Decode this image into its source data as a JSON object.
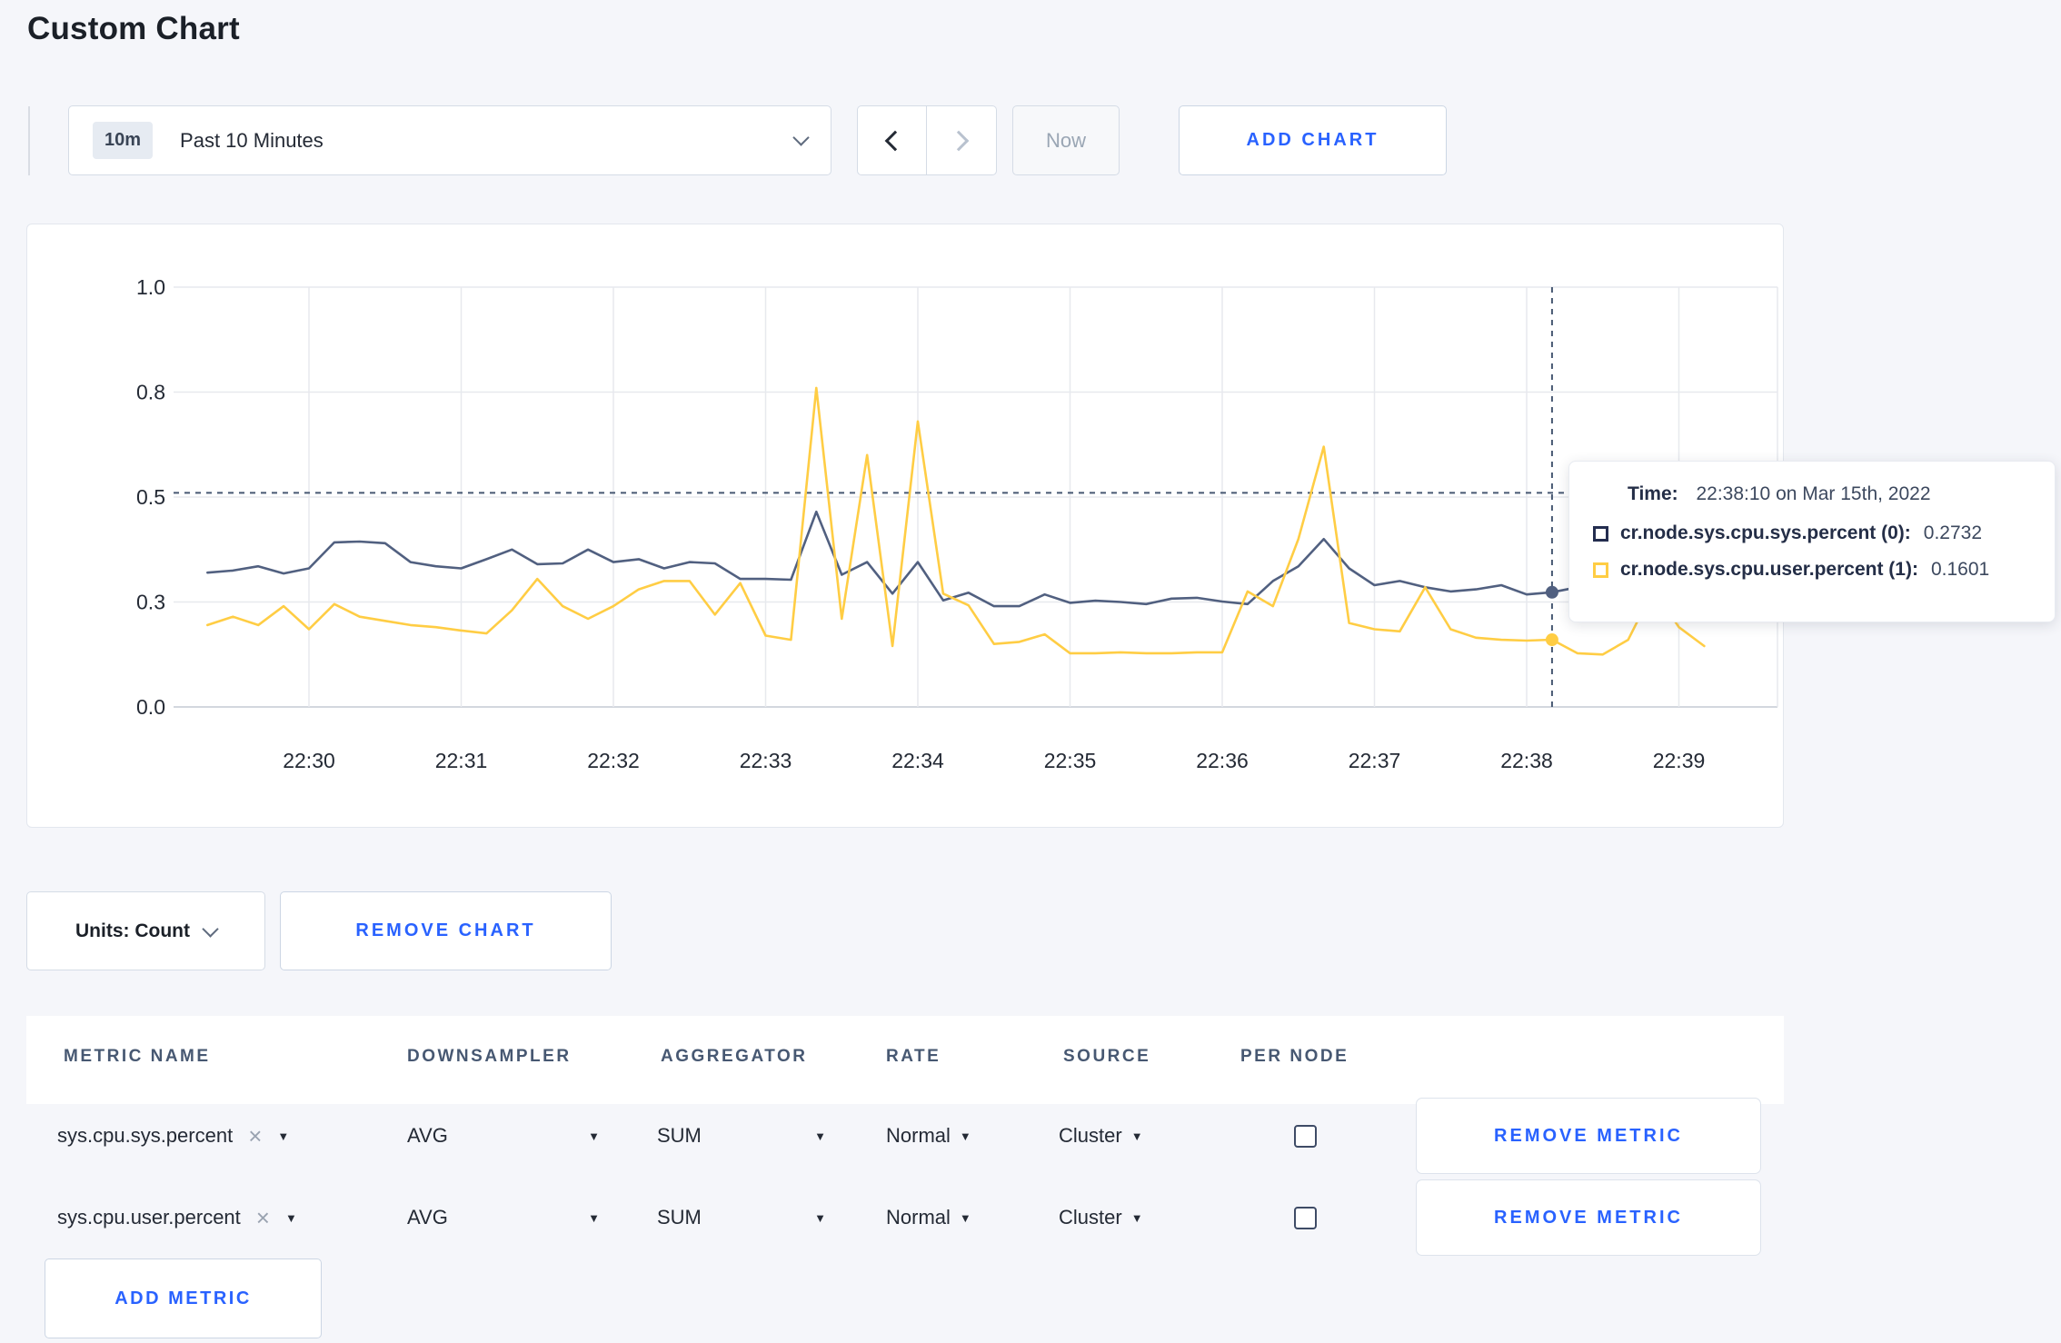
{
  "page": {
    "title": "Custom Chart"
  },
  "toolbar": {
    "time_window": {
      "badge": "10m",
      "label": "Past 10 Minutes"
    },
    "now_label": "Now",
    "add_chart_label": "ADD CHART"
  },
  "chart_card": {
    "tooltip": {
      "time_label": "Time:",
      "time_value": "22:38:10 on Mar 15th, 2022",
      "rows": [
        {
          "name": "cr.node.sys.cpu.sys.percent (0):",
          "value": "0.2732",
          "swatch": "#232d4f"
        },
        {
          "name": "cr.node.sys.cpu.user.percent (1):",
          "value": "0.1601",
          "swatch": "#ffcd44"
        }
      ]
    }
  },
  "chart_data": {
    "type": "line",
    "title": "",
    "xlabel": "",
    "ylabel": "",
    "ylim": [
      0,
      1
    ],
    "grid": true,
    "legend_position": "tooltip",
    "x_ticks": [
      "22:30",
      "22:31",
      "22:32",
      "22:33",
      "22:34",
      "22:35",
      "22:36",
      "22:37",
      "22:38",
      "22:39"
    ],
    "y_ticks": [
      {
        "label": "0.0",
        "value": 0
      },
      {
        "label": "0.3",
        "value": 0.25
      },
      {
        "label": "0.5",
        "value": 0.5
      },
      {
        "label": "0.8",
        "value": 0.75
      },
      {
        "label": "1.0",
        "value": 1.0
      }
    ],
    "x_start": "22:29:20",
    "x_step_seconds": 10,
    "series": [
      {
        "name": "cr.node.sys.cpu.sys.percent (0)",
        "color": "#516080",
        "values": [
          0.32,
          0.325,
          0.335,
          0.318,
          0.33,
          0.392,
          0.394,
          0.39,
          0.345,
          0.335,
          0.33,
          0.352,
          0.375,
          0.34,
          0.342,
          0.375,
          0.345,
          0.352,
          0.33,
          0.345,
          0.342,
          0.305,
          0.305,
          0.303,
          0.465,
          0.315,
          0.345,
          0.27,
          0.345,
          0.254,
          0.272,
          0.24,
          0.24,
          0.268,
          0.248,
          0.253,
          0.25,
          0.245,
          0.258,
          0.26,
          0.251,
          0.245,
          0.3,
          0.335,
          0.4,
          0.33,
          0.29,
          0.3,
          0.285,
          0.275,
          0.28,
          0.29,
          0.268,
          0.2732,
          0.285,
          0.295,
          0.3,
          0.305,
          0.3,
          0.31
        ]
      },
      {
        "name": "cr.node.sys.cpu.user.percent (1)",
        "color": "#ffcd44",
        "values": [
          0.195,
          0.215,
          0.195,
          0.24,
          0.185,
          0.245,
          0.215,
          0.205,
          0.195,
          0.19,
          0.182,
          0.175,
          0.23,
          0.305,
          0.24,
          0.21,
          0.24,
          0.28,
          0.3,
          0.3,
          0.22,
          0.295,
          0.17,
          0.16,
          0.76,
          0.21,
          0.6,
          0.145,
          0.68,
          0.27,
          0.242,
          0.15,
          0.155,
          0.173,
          0.128,
          0.128,
          0.13,
          0.128,
          0.128,
          0.13,
          0.13,
          0.275,
          0.24,
          0.4,
          0.62,
          0.2,
          0.185,
          0.18,
          0.285,
          0.185,
          0.165,
          0.16,
          0.158,
          0.1601,
          0.128,
          0.125,
          0.16,
          0.28,
          0.19,
          0.145
        ]
      }
    ],
    "crosshair": {
      "time": "22:38:10",
      "x_offset_seconds_from_2230": 490,
      "hline_value": 0.51,
      "dot_values": [
        0.2732,
        0.1601
      ]
    }
  },
  "units_row": {
    "units_label": "Units: Count",
    "remove_chart_label": "REMOVE CHART"
  },
  "metrics_table": {
    "columns": [
      "METRIC NAME",
      "DOWNSAMPLER",
      "AGGREGATOR",
      "RATE",
      "SOURCE",
      "PER NODE"
    ],
    "rows": [
      {
        "metric": "sys.cpu.sys.percent",
        "remove_x": "×",
        "downsampler": "AVG",
        "aggregator": "SUM",
        "rate": "Normal",
        "source": "Cluster",
        "per_node_checked": false,
        "remove_label": "REMOVE METRIC"
      },
      {
        "metric": "sys.cpu.user.percent",
        "remove_x": "×",
        "downsampler": "AVG",
        "aggregator": "SUM",
        "rate": "Normal",
        "source": "Cluster",
        "per_node_checked": false,
        "remove_label": "REMOVE METRIC"
      }
    ],
    "add_metric_label": "ADD METRIC"
  },
  "colors": {
    "accent_blue": "#2962ff",
    "series_sys": "#516080",
    "series_user": "#ffcd44",
    "crosshair": "#475872",
    "grid": "#e7e9ee",
    "axis": "#d3d7de"
  }
}
